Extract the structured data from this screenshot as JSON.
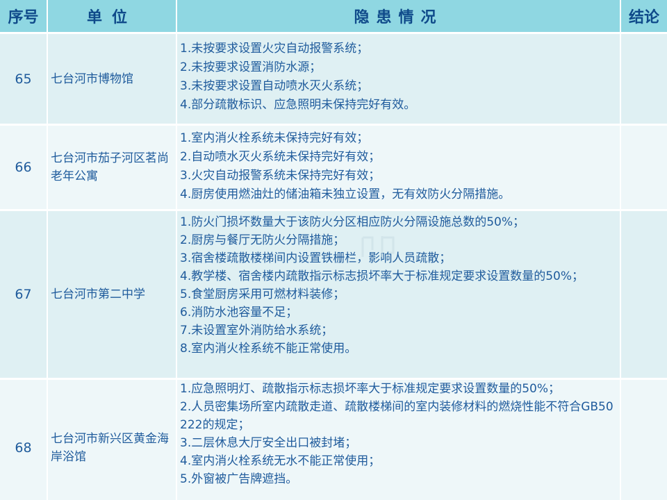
{
  "table": {
    "headers": {
      "no": "序号",
      "unit": "单位",
      "issues": "隐患情况",
      "conclusion": "结论"
    },
    "rows": [
      {
        "no": "65",
        "unit": "七台河市博物馆",
        "issues": [
          "1.未按要求设置火灾自动报警系统；",
          "2.未按要求设置消防水源；",
          "3.未按要求设置自动喷水灭火系统；",
          "4.部分疏散标识、应急照明未保持完好有效。"
        ],
        "conclusion": ""
      },
      {
        "no": "66",
        "unit": "七台河市茄子河区茗尚老年公寓",
        "issues": [
          "1.室内消火栓系统未保持完好有效；",
          "2.自动喷水灭火系统未保持完好有效；",
          "3.火灾自动报警系统未保持完好有效；",
          "4.厨房使用燃油灶的储油箱未独立设置，无有效防火分隔措施。"
        ],
        "conclusion": ""
      },
      {
        "no": "67",
        "unit": "七台河市第二中学",
        "issues": [
          "1.防火门损坏数量大于该防火分区相应防火分隔设施总数的50%；",
          "2.厨房与餐厅无防火分隔措施；",
          "3.宿舍楼疏散楼梯间内设置铁栅栏，影响人员疏散；",
          "4.教学楼、宿舍楼内疏散指示标志损坏率大于标准规定要求设置数量的50%；",
          "5.食堂厨房采用可燃材料装修；",
          "6.消防水池容量不足；",
          "7.未设置室外消防给水系统；",
          "8.室内消火栓系统不能正常使用。"
        ],
        "conclusion": ""
      },
      {
        "no": "68",
        "unit": "七台河市新兴区黄金海岸浴馆",
        "issues": [
          "1.应急照明灯、疏散指示标志损坏率大于标准规定要求设置数量的50%；",
          "2.人员密集场所室内疏散走道、疏散楼梯间的室内装修材料的燃烧性能不符合GB50222的规定；",
          "3.二层休息大厅安全出口被封堵；",
          "4.室内消火栓系统无水不能正常使用；",
          "5.外窗被广告牌遮挡。"
        ],
        "conclusion": ""
      }
    ]
  },
  "colors": {
    "header_bg": "#8fd7e2",
    "header_text": "#0f4a8a",
    "body_text": "#1f5b9c",
    "row_bg_odd": "#dff0f3",
    "row_bg_even": "#eef7f9"
  }
}
